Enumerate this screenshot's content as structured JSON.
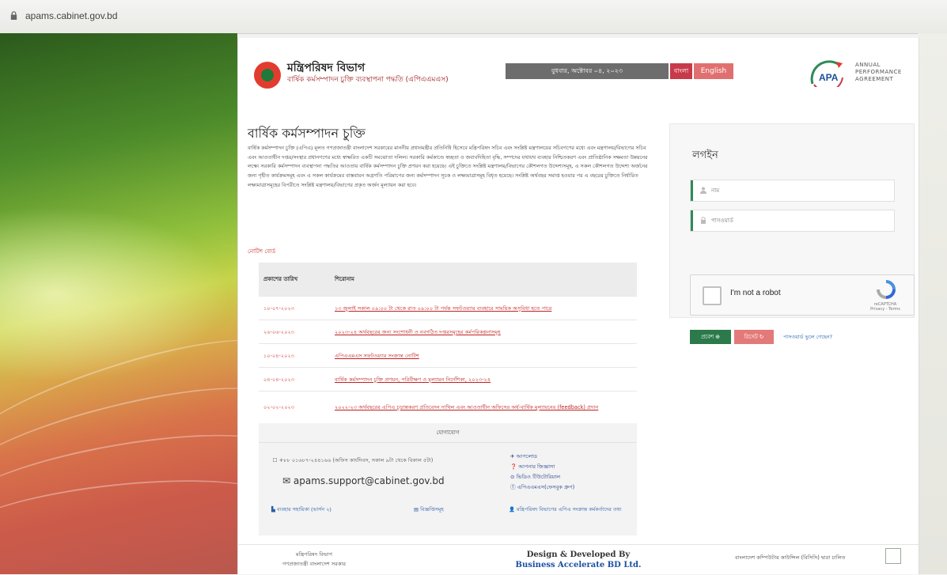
{
  "browser": {
    "url": "apams.cabinet.gov.bd"
  },
  "header": {
    "title": "মন্ত্রিপরিষদ বিভাগ",
    "subtitle": "বার্ষিক কর্মসম্পাদন চুক্তি ব্যবস্থাপনা পদ্ধতি (এপিএএমএস)",
    "date": "বুধবার, অক্টোবর ০৪, ২০২৩",
    "lang_bn": "বাংলা",
    "lang_en": "English",
    "apa_short": "APA",
    "apa_lines": [
      "ANNUAL",
      "PERFORMANCE",
      "AGREEMENT"
    ]
  },
  "main": {
    "title": "বার্ষিক কর্মসম্পাদন চুক্তি",
    "description": "বার্ষিক কর্মসম্পাদন চুক্তি (এপিএ) মূলত গণপ্রজাতন্ত্রী বাংলাদেশ সরকারের মাননীয় প্রধানমন্ত্রীর প্রতিনিধি হিসেবে মন্ত্রিপরিষদ সচিব এবং সংশ্লিষ্ট মন্ত্রণালয়ের সচিবগণের মধ্যে এবং মন্ত্রণালয়/বিভাগের সচিব এবং আওতাধীন দপ্তর/সংস্থার প্রধানগণের মধ্যে স্বাক্ষরিত একটি সমঝোতা দলিল। সরকারি কর্মকাণ্ডে স্বচ্ছতা ও জবাবদিহিতা বৃদ্ধি, সম্পদের যথাযথ ব্যবহার নিশ্চিতকরণ এবং প্রাতিষ্ঠানিক সক্ষমতা উন্নয়নের লক্ষ্যে সরকারি কর্মসম্পাদন ব্যবস্থাপনা পদ্ধতির আওতায় বার্ষিক কর্মসম্পাদন চুক্তি প্রণয়ন করা হয়েছে। এই চুক্তিতে সংশ্লিষ্ট মন্ত্রণালয়/বিভাগের কৌশলগত উদ্দেশ্যসমূহ, এ সকল কৌশলগত উদ্দেশ্য অর্জনের জন্য গৃহীত কার্যক্রমসমূহ এবং এ সকল কার্যক্রমের বাস্তবায়ন অগ্রগতি পরিমাপের জন্য কর্মসম্পাদন সূচক ও লক্ষ্যমাত্রাসমূহ বিধৃত হয়েছে। সংশ্লিষ্ট অর্থবছর সমাপ্ত হওয়ার পর এ বছরের চুক্তিতে নির্ধারিত লক্ষ্যমাত্রাসমূহের বিপরীতে সংশ্লিষ্ট মন্ত্রণালয়/বিভাগের প্রকৃত অর্জন মূল্যায়ন করা হবে।"
  },
  "notice_board": {
    "heading": "নোটিশ বোর্ড",
    "col_date": "প্রকাশের তারিখ",
    "col_title": "শিরোনাম",
    "rows": [
      {
        "date": "১০-০৭-২০২৩",
        "title": "১৩ জুলাই সকাল ০৯:০০ টা থেকে রাত ০৯:০০ টা পর্যন্ত সফটওয়্যার ব্যবহারে সাময়িক অসুবিধা হতে পারে"
      },
      {
        "date": "২৬-০৬-২০২৩",
        "title": "২০২৩-২৪ অর্থবছরের জন্য সংশোধনী ও নবগঠিত দপ্তরসমূহের কর্মপরিকল্পনাসমূহ"
      },
      {
        "date": "১০-০৪-২০২৩",
        "title": "এপিএএমএস সফটওয়্যার সংক্রান্ত নোটিশ"
      },
      {
        "date": "০৪-০৪-২০২৩",
        "title": "বার্ষিক কর্মসম্পাদন চুক্তি প্রণয়ন, পরিবীক্ষণ ও মূল্যায়ন নির্দেশিকা, ২০২৩-২৪"
      },
      {
        "date": "০২-০২-২০২৩",
        "title": "২০২২-২৩ অর্থবছরের এপিএ চূড়ান্তকরণ প্রতিবেদন দাখিল এবং আওতাধীন অফিসের অর্ধ-বার্ষিক মূল্যায়নের (feedback) প্রদান"
      }
    ]
  },
  "contact": {
    "heading": "যোগাযোগ",
    "phone": "+৮৮ ০১৬৮৭-২৪৪১৬৬ (অফিস কার্যদিবস, সকাল ৯টা থেকে বিকাল ৫টা)",
    "email": "apams.support@cabinet.gov.bd",
    "links": [
      "আপলোড",
      "আপনার জিজ্ঞাসা",
      "ভিডিও টিউটোরিয়াল",
      "এপিএএমএস(ফেসবুক গ্রুপ)"
    ],
    "bottom_links": [
      "ব্যবহার সহায়িকা (ভার্সন ২)",
      "বিজ্ঞপ্তিসমূহ",
      "মন্ত্রিপরিষদ বিভাগের এপিএ সংক্রান্ত কর্মকর্তাদের তথ্য"
    ]
  },
  "login": {
    "title": "লগইন",
    "username_placeholder": "নাম",
    "password_placeholder": "পাসওয়ার্ড",
    "captcha_label": "I'm not a robot",
    "captcha_brand": "reCAPTCHA",
    "captcha_terms": "Privacy - Terms",
    "login_btn": "প্রবেশ",
    "reset_btn": "রিসেট",
    "forgot": "পাসওয়ার্ড ভুলে গেছেন?"
  },
  "footer": {
    "left_line1": "মন্ত্রিপরিষদ বিভাগ",
    "left_line2": "গণপ্রজাতন্ত্রী বাংলাদেশ সরকার",
    "mid_line1": "Design & Developed By",
    "mid_line2": "Business Accelerate BD Ltd.",
    "right": "বাংলাদেশ কম্পিউটার কাউন্সিল (বিসিসি) দ্বারা চালিত"
  }
}
